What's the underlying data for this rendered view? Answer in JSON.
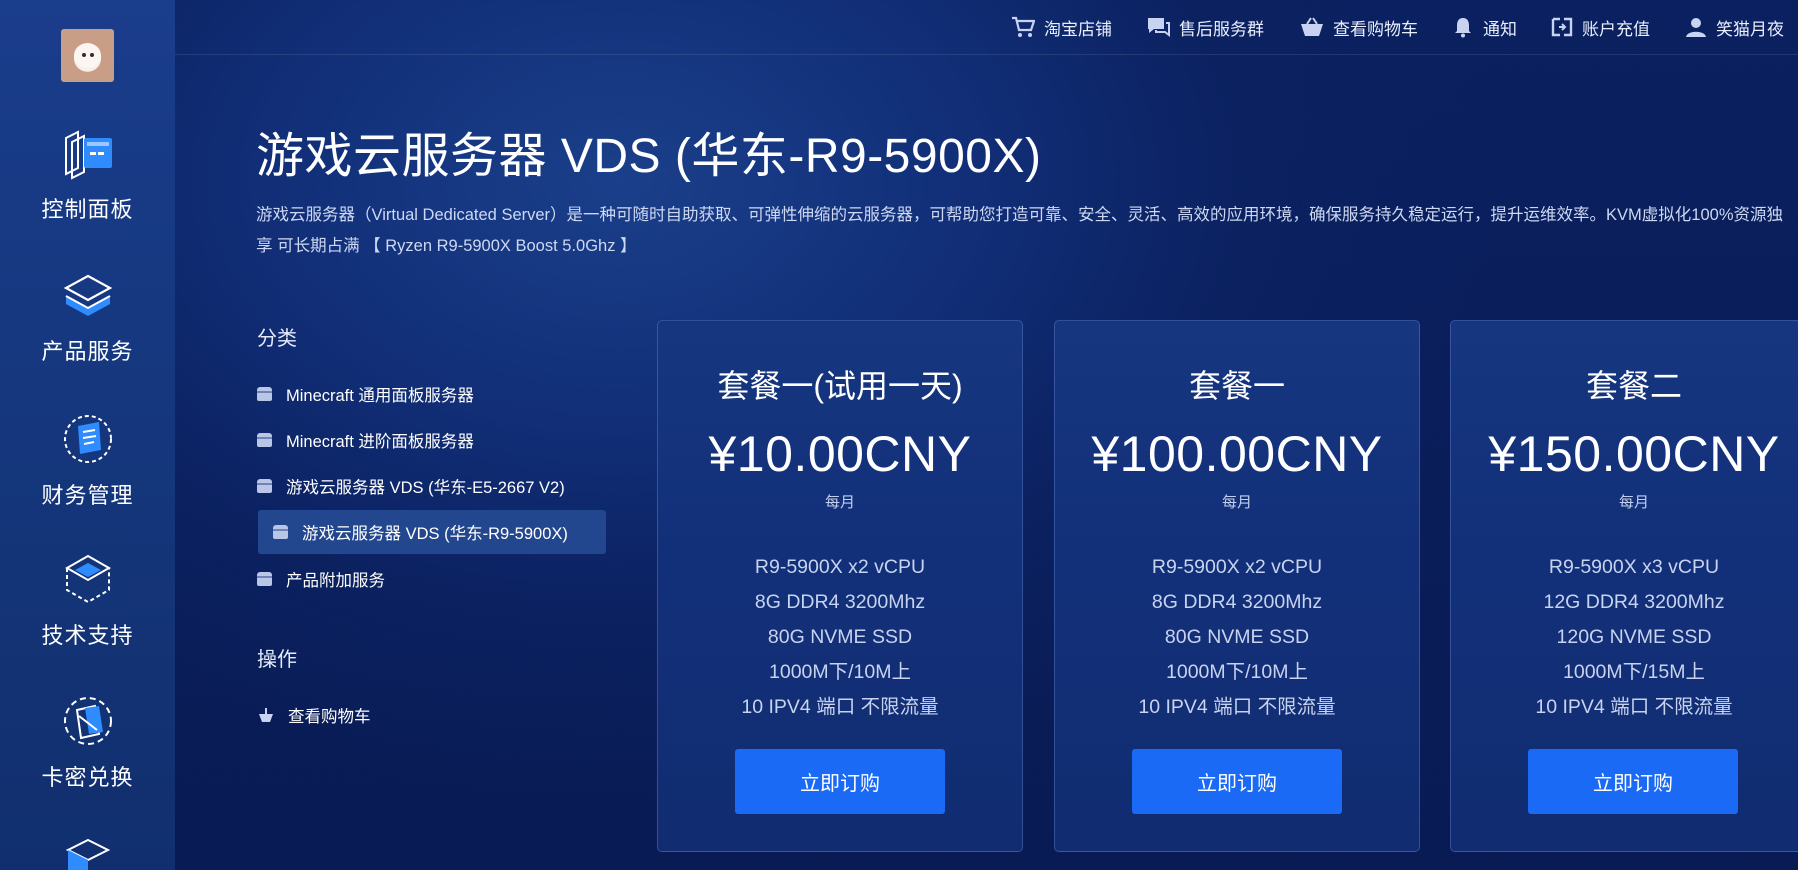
{
  "sidebar": {
    "items": [
      {
        "label": "控制面板",
        "icon": "dashboard-icon"
      },
      {
        "label": "产品服务",
        "icon": "layers-icon"
      },
      {
        "label": "财务管理",
        "icon": "finance-icon"
      },
      {
        "label": "技术支持",
        "icon": "support-box-icon"
      },
      {
        "label": "卡密兑换",
        "icon": "card-redeem-icon"
      }
    ]
  },
  "topbar": {
    "items": [
      {
        "label": "淘宝店铺",
        "icon": "cart-icon"
      },
      {
        "label": "售后服务群",
        "icon": "chat-icon"
      },
      {
        "label": "查看购物车",
        "icon": "basket-icon"
      },
      {
        "label": "通知",
        "icon": "bell-icon"
      },
      {
        "label": "账户充值",
        "icon": "recharge-icon"
      },
      {
        "label": "笑猫月夜",
        "icon": "user-icon"
      }
    ]
  },
  "page": {
    "title": "游戏云服务器 VDS (华东-R9-5900X)",
    "description": "游戏云服务器（Virtual Dedicated Server）是一种可随时自助获取、可弹性伸缩的云服务器，可帮助您打造可靠、安全、灵活、高效的应用环境，确保服务持久稳定运行，提升运维效率。KVM虚拟化100%资源独享 可长期占满 【 Ryzen R9-5900X Boost 5.0Ghz 】"
  },
  "categories": {
    "title": "分类",
    "items": [
      "Minecraft 通用面板服务器",
      "Minecraft 进阶面板服务器",
      "游戏云服务器 VDS (华东-E5-2667 V2)",
      "游戏云服务器 VDS (华东-R9-5900X)",
      "产品附加服务"
    ],
    "active_index": 3
  },
  "actions": {
    "title": "操作",
    "items": [
      "查看购物车"
    ]
  },
  "products": [
    {
      "name": "套餐一(试用一天)",
      "price": "¥10.00CNY",
      "period": "每月",
      "specs": [
        "R9-5900X x2 vCPU",
        "8G DDR4 3200Mhz",
        "80G NVME SSD",
        "1000M下/10M上",
        "10 IPV4 端口 不限流量"
      ],
      "button": "立即订购"
    },
    {
      "name": "套餐一",
      "price": "¥100.00CNY",
      "period": "每月",
      "specs": [
        "R9-5900X x2 vCPU",
        "8G DDR4 3200Mhz",
        "80G NVME SSD",
        "1000M下/10M上",
        "10 IPV4 端口 不限流量"
      ],
      "button": "立即订购"
    },
    {
      "name": "套餐二",
      "price": "¥150.00CNY",
      "period": "每月",
      "specs": [
        "R9-5900X x3 vCPU",
        "12G DDR4 3200Mhz",
        "120G NVME SSD",
        "1000M下/15M上",
        "10 IPV4 端口 不限流量"
      ],
      "button": "立即订购"
    }
  ],
  "colors": {
    "background": "#0a1f5c",
    "sidebar": "#163782",
    "accent_button": "#1a6af5",
    "active_category": "#23478f",
    "icon_blue": "#2f8cff"
  }
}
